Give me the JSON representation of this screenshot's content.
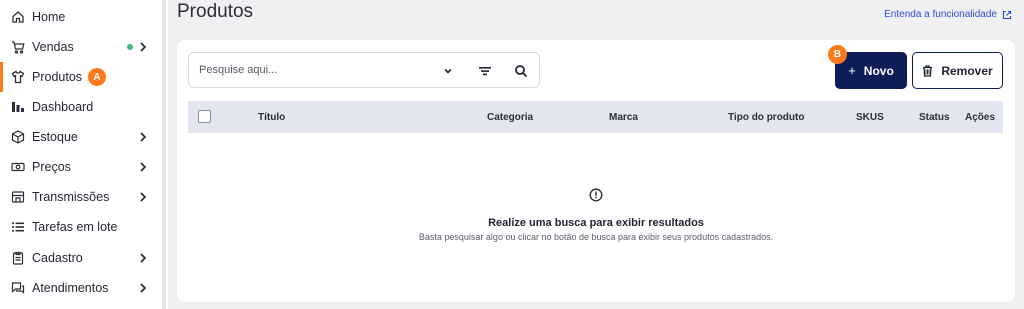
{
  "sidebar": {
    "items": [
      {
        "label": "Home",
        "icon": "home-icon"
      },
      {
        "label": "Vendas",
        "icon": "cart-icon"
      },
      {
        "label": "Produtos",
        "icon": "shirt-icon",
        "badge": "A"
      },
      {
        "label": "Dashboard",
        "icon": "bar-chart-icon"
      },
      {
        "label": "Estoque",
        "icon": "box-icon"
      },
      {
        "label": "Preços",
        "icon": "money-icon"
      },
      {
        "label": "Transmissões",
        "icon": "store-icon"
      },
      {
        "label": "Tarefas em lote",
        "icon": "list-icon"
      },
      {
        "label": "Cadastro",
        "icon": "clipboard-icon"
      },
      {
        "label": "Atendimentos",
        "icon": "chat-icon"
      }
    ]
  },
  "header": {
    "title": "Produtos",
    "help_link": "Entenda a funcionalidade"
  },
  "search": {
    "placeholder": "Pesquise aqui..."
  },
  "actions": {
    "new_label": "Novo",
    "new_badge": "B",
    "remove_label": "Remover"
  },
  "table": {
    "columns": [
      "Título",
      "Categoria",
      "Marca",
      "Tipo do produto",
      "SKUS",
      "Status",
      "Ações"
    ]
  },
  "empty_state": {
    "title": "Realize uma busca para exibir resultados",
    "subtitle": "Basta pesquisar algo ou clicar no botão de busca para exibir seus produtos cadastrados."
  },
  "colors": {
    "accent": "#ff7a1a",
    "primary": "#0d1d58",
    "link": "#2d4cd6",
    "online_dot": "#3fbf7f"
  }
}
